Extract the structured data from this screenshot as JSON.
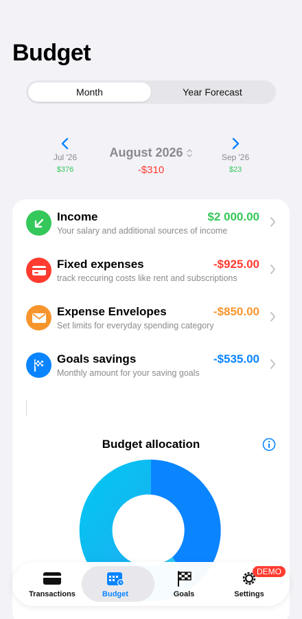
{
  "header": {
    "title": "Budget"
  },
  "segmented": {
    "options": [
      "Month",
      "Year Forecast"
    ],
    "selected": "Month"
  },
  "month_nav": {
    "prev": {
      "label": "Jul '26",
      "amount": "$376"
    },
    "current": {
      "label": "August 2026",
      "amount": "-$310"
    },
    "next": {
      "label": "Sep '26",
      "amount": "$23"
    }
  },
  "rows": [
    {
      "title": "Income",
      "subtitle": "Your salary and additional sources of income",
      "amount": "$2 000.00",
      "color": "#34c759",
      "icon": "arrow-down-left-icon"
    },
    {
      "title": "Fixed expenses",
      "subtitle": "track reccuring costs like rent and subscriptions",
      "amount": "-$925.00",
      "color": "#ff3b30",
      "icon": "credit-card-icon"
    },
    {
      "title": "Expense Envelopes",
      "subtitle": "Set limits for everyday spending category",
      "amount": "-$850.00",
      "color": "#f7952d",
      "icon": "envelope-icon"
    },
    {
      "title": "Goals savings",
      "subtitle": "Monthly amount for your saving goals",
      "amount": "-$535.00",
      "color": "#0a84ff",
      "icon": "flag-icon"
    }
  ],
  "allocation": {
    "title": "Budget allocation",
    "colors": [
      "#0a84ff",
      "#30c8f0",
      "#00c8f0"
    ]
  },
  "tabbar": {
    "tabs": [
      {
        "label": "Transactions",
        "icon": "wallet-icon"
      },
      {
        "label": "Budget",
        "icon": "calendar-icon",
        "active": true
      },
      {
        "label": "Goals",
        "icon": "checkered-flag-icon"
      },
      {
        "label": "Settings",
        "icon": "gear-icon"
      }
    ],
    "badge": "DEMO"
  }
}
